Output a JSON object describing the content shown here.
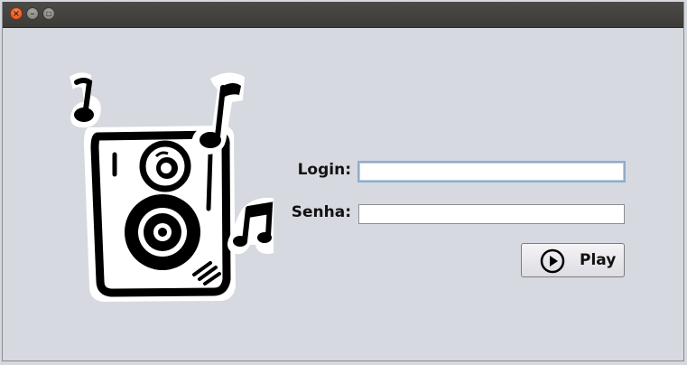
{
  "window": {
    "controls": [
      "close-icon",
      "minimize-icon",
      "maximize-icon"
    ]
  },
  "form": {
    "login_label": "Login:",
    "login_value": "",
    "password_label": "Senha:",
    "password_value": "",
    "play_label": "Play"
  },
  "icons": {
    "illustration": "speaker-with-music-notes",
    "play_button_icon": "play-circle-icon"
  },
  "colors": {
    "background": "#d7d9e0",
    "titlebar": "#3c3b37",
    "focus_border": "#8faccd"
  }
}
